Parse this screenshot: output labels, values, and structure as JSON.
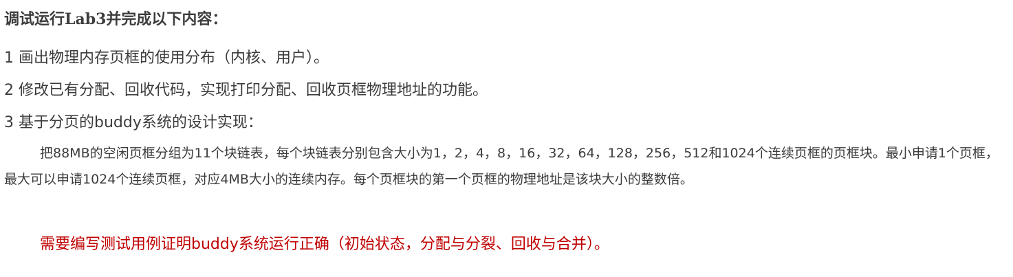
{
  "document": {
    "heading": "调试运行Lab3并完成以下内容：",
    "items": [
      "1 画出物理内存页框的使用分布（内核、用户）。",
      "2 修改已有分配、回收代码，实现打印分配、回收页框物理地址的功能。",
      "3 基于分页的buddy系统的设计实现："
    ],
    "description": "把88MB的空闲页框分组为11个块链表，每个块链表分别包含大小为1，2，4，8，16，32，64，128，256，512和1024个连续页框的页框块。最小申请1个页框，最大可以申请1024个连续页框，对应4MB大小的连续内存。每个页框块的第一个页框的物理地址是该块大小的整数倍。",
    "note": "需要编写测试用例证明buddy系统运行正确（初始状态，分配与分裂、回收与合并）。",
    "note_color": "#c00000"
  }
}
